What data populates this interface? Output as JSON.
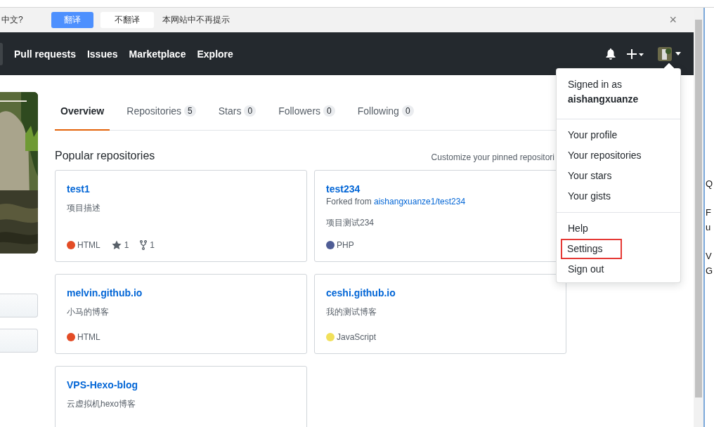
{
  "translate_bar": {
    "prompt": "中文?",
    "buttons": [
      {
        "label": "翻译",
        "primary": true
      },
      {
        "label": "不翻译",
        "primary": false
      }
    ],
    "never_text": "本网站中不再提示",
    "close": "×"
  },
  "header": {
    "nav": [
      "Pull requests",
      "Issues",
      "Marketplace",
      "Explore"
    ]
  },
  "tabs": [
    {
      "label": "Overview",
      "selected": true
    },
    {
      "label": "Repositories",
      "count": "5",
      "selected": false
    },
    {
      "label": "Stars",
      "count": "0",
      "selected": false
    },
    {
      "label": "Followers",
      "count": "0",
      "selected": false
    },
    {
      "label": "Following",
      "count": "0",
      "selected": false
    }
  ],
  "section_title": "Popular repositories",
  "customize_link": "Customize your pinned repositori",
  "repos": [
    {
      "name": "test1",
      "description": "项目描述",
      "language": "HTML",
      "color": "#e34c26",
      "star_count": "1",
      "fork_count": "1"
    },
    {
      "name": "test234",
      "forked_label": "Forked from",
      "forked_from": "aishangxuanze1/test234",
      "description": "项目测试234",
      "language": "PHP",
      "color": "#4f5d95"
    },
    {
      "name": "melvin.github.io",
      "description": "小马的博客",
      "language": "HTML",
      "color": "#e34c26"
    },
    {
      "name": "ceshi.github.io",
      "description": "我的测试博客",
      "language": "JavaScript",
      "color": "#f1e05a"
    },
    {
      "name": "VPS-Hexo-blog",
      "description": "云虚拟机hexo博客"
    }
  ],
  "user_menu": {
    "signed_in_label": "Signed in as",
    "username": "aishangxuanze",
    "groups": [
      [
        {
          "label": "Your profile",
          "highlighted": false
        },
        {
          "label": "Your repositories",
          "highlighted": false
        },
        {
          "label": "Your stars",
          "highlighted": false
        },
        {
          "label": "Your gists",
          "highlighted": false
        }
      ],
      [
        {
          "label": "Help",
          "highlighted": false
        },
        {
          "label": "Settings",
          "highlighted": true
        },
        {
          "label": "Sign out",
          "highlighted": false
        }
      ]
    ]
  },
  "background_window": {
    "fragments": [
      [
        "Q"
      ],
      [
        "F",
        "u"
      ],
      [
        "V",
        "G"
      ]
    ]
  }
}
